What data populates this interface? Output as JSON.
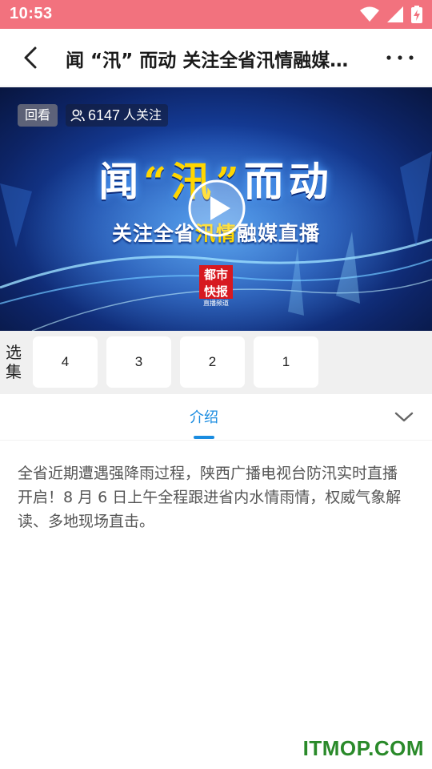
{
  "status_bar": {
    "time": "10:53",
    "icons": [
      "wifi-icon",
      "signal-icon",
      "battery-charging-icon"
    ]
  },
  "app_bar": {
    "title": "闻 “汛” 而动 关注全省汛情融媒直播",
    "back_icon": "chevron-left-icon",
    "more_icon": "more-dots-icon"
  },
  "video": {
    "replay_label": "回看",
    "watch_count": "6147",
    "watch_suffix": "人关注",
    "headline_pre": "闻",
    "headline_hl": "“汛”",
    "headline_post": "而动",
    "subline_pre": "关注全省",
    "subline_hl": "汛情",
    "subline_post": "融媒直播",
    "logo_text": [
      "都市",
      "快报",
      "直播频道"
    ],
    "accent_color": "#ffd600"
  },
  "episodes": {
    "label": "选集",
    "items": [
      "4",
      "3",
      "2",
      "1"
    ]
  },
  "tabs": {
    "intro_label": "介绍",
    "active_color": "#1a8ce0"
  },
  "description": "全省近期遭遇强降雨过程，陕西广播电视台防汛实时直播开启！8 月 6 日上午全程跟进省内水情雨情，权威气象解读、多地现场直击。",
  "watermark": "ITMOP.COM"
}
